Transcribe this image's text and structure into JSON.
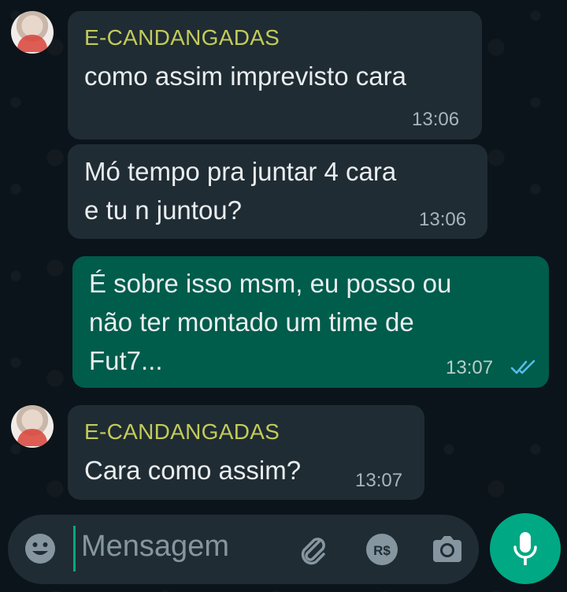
{
  "messages": [
    {
      "direction": "incoming",
      "sender": "E-CANDANGADAS",
      "text": "como assim imprevisto cara",
      "time": "13:06"
    },
    {
      "direction": "incoming",
      "sender": "",
      "text": "Mó tempo pra juntar 4 cara\ne tu n juntou?",
      "time": "13:06"
    },
    {
      "direction": "outgoing",
      "text": "É sobre isso msm, eu posso ou\nnão ter montado um time de\nFut7...",
      "time": "13:07",
      "status": "read"
    },
    {
      "direction": "incoming",
      "sender": "E-CANDANGADAS",
      "text": "Cara como assim?",
      "time": "13:07"
    }
  ],
  "composer": {
    "placeholder": "Mensagem",
    "icons": [
      "emoji-icon",
      "attach-icon",
      "payment-icon",
      "camera-icon",
      "microphone-icon"
    ]
  },
  "colors": {
    "background": "#0b141a",
    "incoming_bubble": "#202c33",
    "outgoing_bubble": "#005c4b",
    "sender_name": "#c2cb5a",
    "accent": "#00a884",
    "read_ticks": "#53bdeb"
  }
}
